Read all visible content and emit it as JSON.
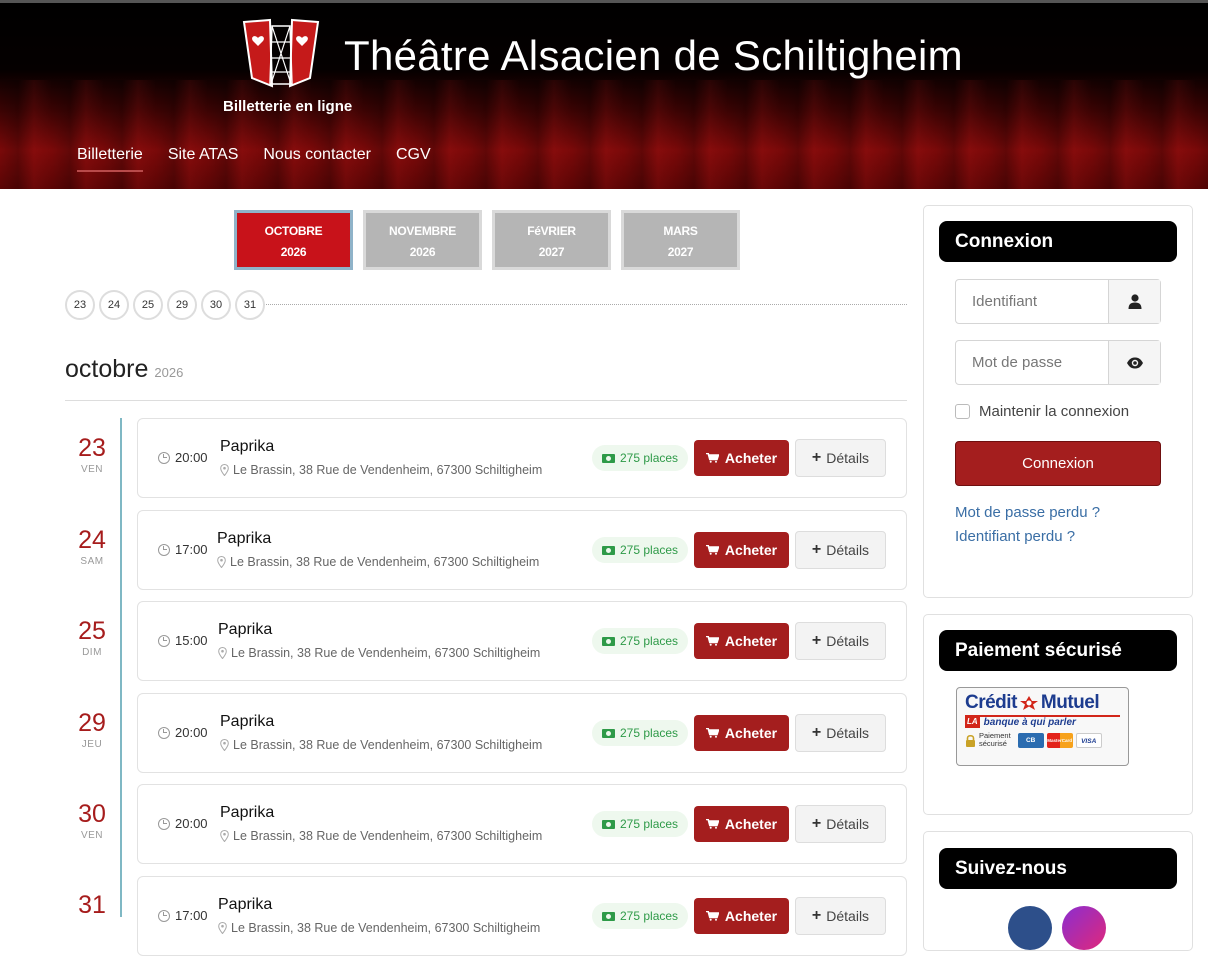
{
  "header": {
    "site_title": "Théâtre Alsacien de Schiltigheim",
    "subtitle": "Billetterie en ligne",
    "nav": [
      {
        "label": "Billetterie",
        "active": true
      },
      {
        "label": "Site ATAS",
        "active": false
      },
      {
        "label": "Nous contacter",
        "active": false
      },
      {
        "label": "CGV",
        "active": false
      }
    ]
  },
  "months": [
    {
      "month": "OCTOBRE",
      "year": "2026",
      "active": true
    },
    {
      "month": "NOVEMBRE",
      "year": "2026",
      "active": false
    },
    {
      "month": "FéVRIER",
      "year": "2027",
      "active": false
    },
    {
      "month": "MARS",
      "year": "2027",
      "active": false
    }
  ],
  "days": [
    "23",
    "24",
    "25",
    "29",
    "30",
    "31"
  ],
  "month_heading": {
    "month": "octobre",
    "year": "2026"
  },
  "events": [
    {
      "day": "23",
      "dow": "VEN",
      "time": "20:00",
      "title": "Paprika",
      "location": "Le Brassin, 38 Rue de Vendenheim, 67300 Schiltigheim",
      "places": "275 places",
      "buy_label": "Acheter",
      "details_label": "Détails"
    },
    {
      "day": "24",
      "dow": "SAM",
      "time": "17:00",
      "title": "Paprika",
      "location": "Le Brassin, 38 Rue de Vendenheim, 67300 Schiltigheim",
      "places": "275 places",
      "buy_label": "Acheter",
      "details_label": "Détails"
    },
    {
      "day": "25",
      "dow": "DIM",
      "time": "15:00",
      "title": "Paprika",
      "location": "Le Brassin, 38 Rue de Vendenheim, 67300 Schiltigheim",
      "places": "275 places",
      "buy_label": "Acheter",
      "details_label": "Détails"
    },
    {
      "day": "29",
      "dow": "JEU",
      "time": "20:00",
      "title": "Paprika",
      "location": "Le Brassin, 38 Rue de Vendenheim, 67300 Schiltigheim",
      "places": "275 places",
      "buy_label": "Acheter",
      "details_label": "Détails"
    },
    {
      "day": "30",
      "dow": "VEN",
      "time": "20:00",
      "title": "Paprika",
      "location": "Le Brassin, 38 Rue de Vendenheim, 67300 Schiltigheim",
      "places": "275 places",
      "buy_label": "Acheter",
      "details_label": "Détails"
    },
    {
      "day": "31",
      "dow": "",
      "time": "17:00",
      "title": "Paprika",
      "location": "Le Brassin, 38 Rue de Vendenheim, 67300 Schiltigheim",
      "places": "275 places",
      "buy_label": "Acheter",
      "details_label": "Détails"
    }
  ],
  "sidebar": {
    "login": {
      "title": "Connexion",
      "username_placeholder": "Identifiant",
      "password_placeholder": "Mot de passe",
      "remember_label": "Maintenir la connexion",
      "submit_label": "Connexion",
      "forgot_password": "Mot de passe perdu ?",
      "forgot_username": "Identifiant perdu ?"
    },
    "payment": {
      "title": "Paiement sécurisé",
      "bank_logo": {
        "name_part1": "Crédit",
        "name_part2": "Mutuel",
        "tag_la": "LA",
        "tagline": "banque à qui parler",
        "secure_line1": "Paiement",
        "secure_line2": "sécurisé",
        "cards": [
          "CB",
          "MasterCard",
          "VISA"
        ]
      }
    },
    "social": {
      "title": "Suivez-nous"
    }
  },
  "colors": {
    "brand_red": "#a41e1e",
    "active_month": "#c8121a",
    "places_green": "#2e9a48",
    "link_blue": "#3a6ea5"
  }
}
